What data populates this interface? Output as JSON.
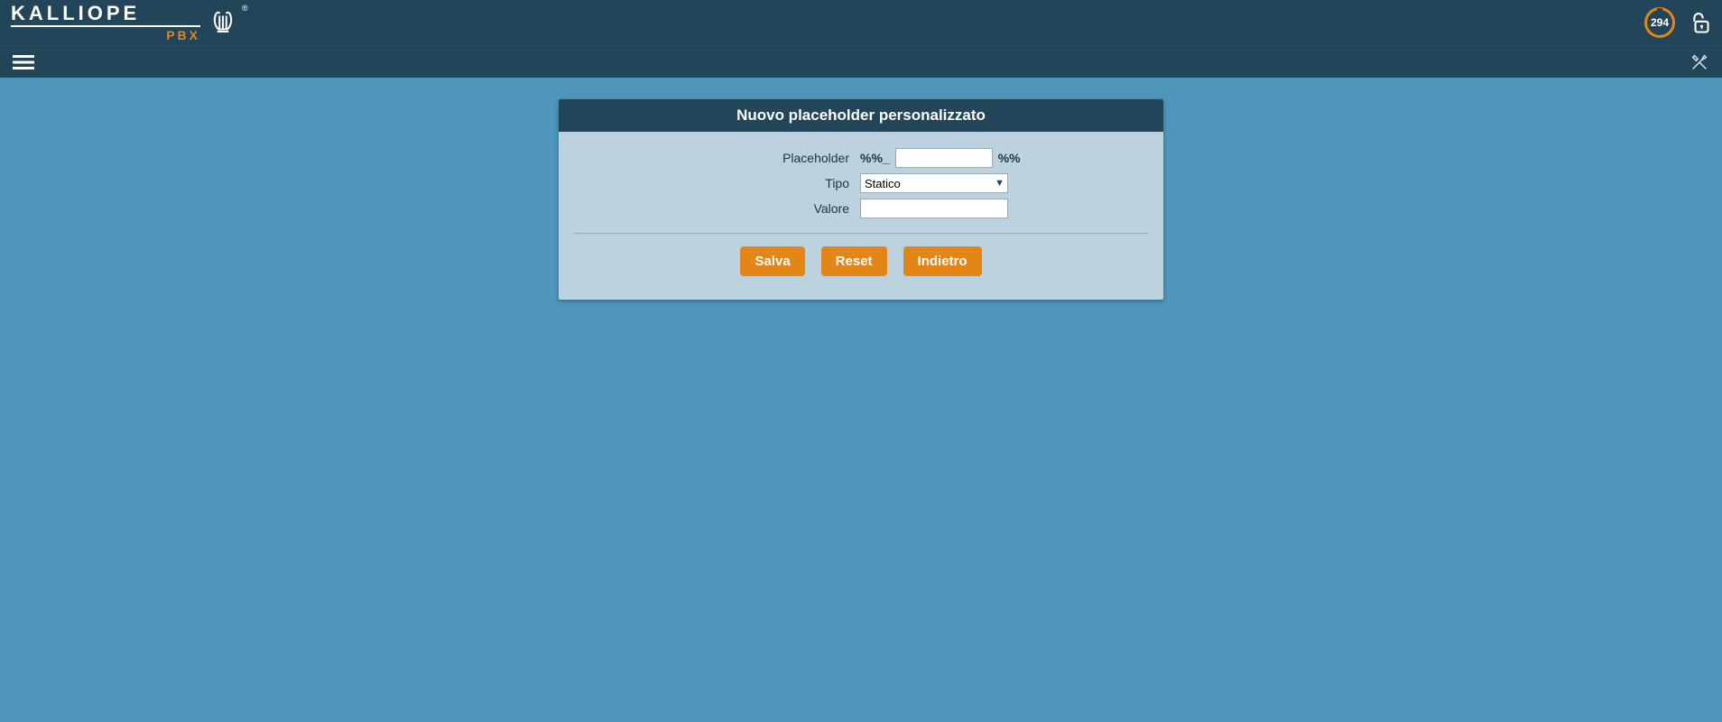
{
  "header": {
    "logo_main": "KALLIOPE",
    "logo_sub": "PBX",
    "counter": "294"
  },
  "panel": {
    "title": "Nuovo placeholder personalizzato"
  },
  "form": {
    "placeholder_label": "Placeholder",
    "placeholder_prefix": "%%_",
    "placeholder_suffix": "%%",
    "placeholder_value": "",
    "tipo_label": "Tipo",
    "tipo_selected": "Statico",
    "valore_label": "Valore",
    "valore_value": ""
  },
  "actions": {
    "save": "Salva",
    "reset": "Reset",
    "back": "Indietro"
  }
}
